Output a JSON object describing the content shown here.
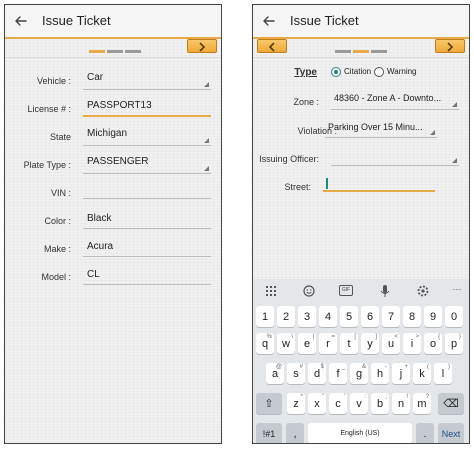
{
  "app": {
    "title": "Issue Ticket"
  },
  "left": {
    "fields": [
      {
        "label": "Vehicle :",
        "value": "Car",
        "dropdown": true
      },
      {
        "label": "License # :",
        "value": "PASSPORT13",
        "dropdown": false
      },
      {
        "label": "State",
        "value": "Michigan",
        "dropdown": true
      },
      {
        "label": "Plate Type :",
        "value": "PASSENGER",
        "dropdown": true
      },
      {
        "label": "VIN :",
        "value": "",
        "dropdown": false
      },
      {
        "label": "Color :",
        "value": "Black",
        "dropdown": false
      },
      {
        "label": "Make :",
        "value": "Acura",
        "dropdown": false
      },
      {
        "label": "Model :",
        "value": "CL",
        "dropdown": false
      }
    ],
    "progress": "step 1 of 3"
  },
  "right": {
    "type_label": "Type",
    "type_options": [
      "Citation",
      "Warning"
    ],
    "type_selected": "Citation",
    "zone_label": "Zone :",
    "zone_value": "48360 - Zone A - Downto...",
    "violation_label": "Violation :",
    "violation_value": "Parking Over 15 Minu...",
    "officer_label": "Issuing Officer:",
    "officer_value": "",
    "street_label": "Street:",
    "street_value": "",
    "progress": "step 2 of 3"
  },
  "keyboard": {
    "toolbar_icons": [
      "grid-icon",
      "emoji-icon",
      "gif-icon",
      "microphone-icon",
      "settings-icon",
      "more-icon"
    ],
    "gif_label": "GIF",
    "more_label": "···",
    "number_row": [
      "1",
      "2",
      "3",
      "4",
      "5",
      "6",
      "7",
      "8",
      "9",
      "0"
    ],
    "row1": [
      "q",
      "w",
      "e",
      "r",
      "t",
      "y",
      "u",
      "i",
      "o",
      "p"
    ],
    "row1_sup": [
      "%",
      "\\",
      "|",
      "=",
      "[",
      "]",
      "<",
      ">",
      "{",
      "}"
    ],
    "row2": [
      "a",
      "s",
      "d",
      "f",
      "g",
      "h",
      "j",
      "k",
      "l"
    ],
    "row2_sup": [
      "@",
      "#",
      "$",
      "_",
      "&",
      "-",
      "+",
      "(",
      ")"
    ],
    "row3": [
      "z",
      "x",
      "c",
      "v",
      "b",
      "n",
      "m"
    ],
    "row3_sup": [
      "*",
      "\"",
      "'",
      ":",
      ";",
      "!",
      "?"
    ],
    "shift": "⇧",
    "backspace": "⌫",
    "symbols": "!#1",
    "comma": ",",
    "space": "English (US)",
    "period": ".",
    "next": "Next"
  },
  "colors": {
    "accent": "#e8a948",
    "nav_button": "#f2b34a",
    "radio_selected": "#1a8a7d",
    "dash_active": "#e8a948",
    "dash_inactive": "#9a9a9a"
  }
}
